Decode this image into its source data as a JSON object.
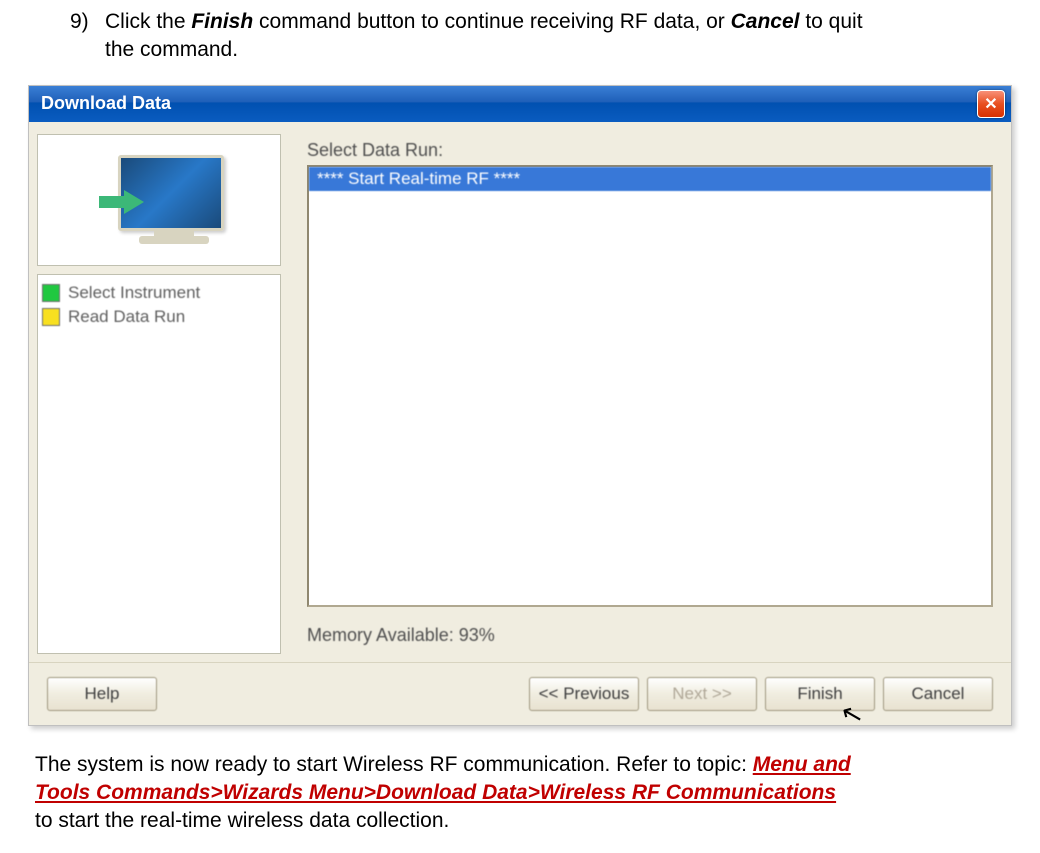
{
  "instruction": {
    "number": "9)",
    "prefix": "Click the ",
    "button1": "Finish",
    "mid1": " command button to continue receiving RF data, or ",
    "button2": "Cancel",
    "mid2": " to quit",
    "line2": "the command."
  },
  "dialog": {
    "title": "Download Data",
    "close_label": "X",
    "steps": [
      {
        "label": "Select Instrument"
      },
      {
        "label": "Read Data Run"
      }
    ],
    "select_label": "Select Data Run:",
    "list_item": "**** Start Real-time RF ****",
    "memory_label": "Memory Available: 93%",
    "buttons": {
      "help": "Help",
      "previous": "<< Previous",
      "next": "Next >>",
      "finish": "Finish",
      "cancel": "Cancel"
    }
  },
  "footer": {
    "prefix": "The system is now ready to start Wireless RF communication. Refer to topic: ",
    "link1": "Menu and",
    "link2": "Tools Commands>Wizards Menu>Download Data>Wireless RF Communications",
    "suffix": "to start the real-time wireless data collection."
  }
}
